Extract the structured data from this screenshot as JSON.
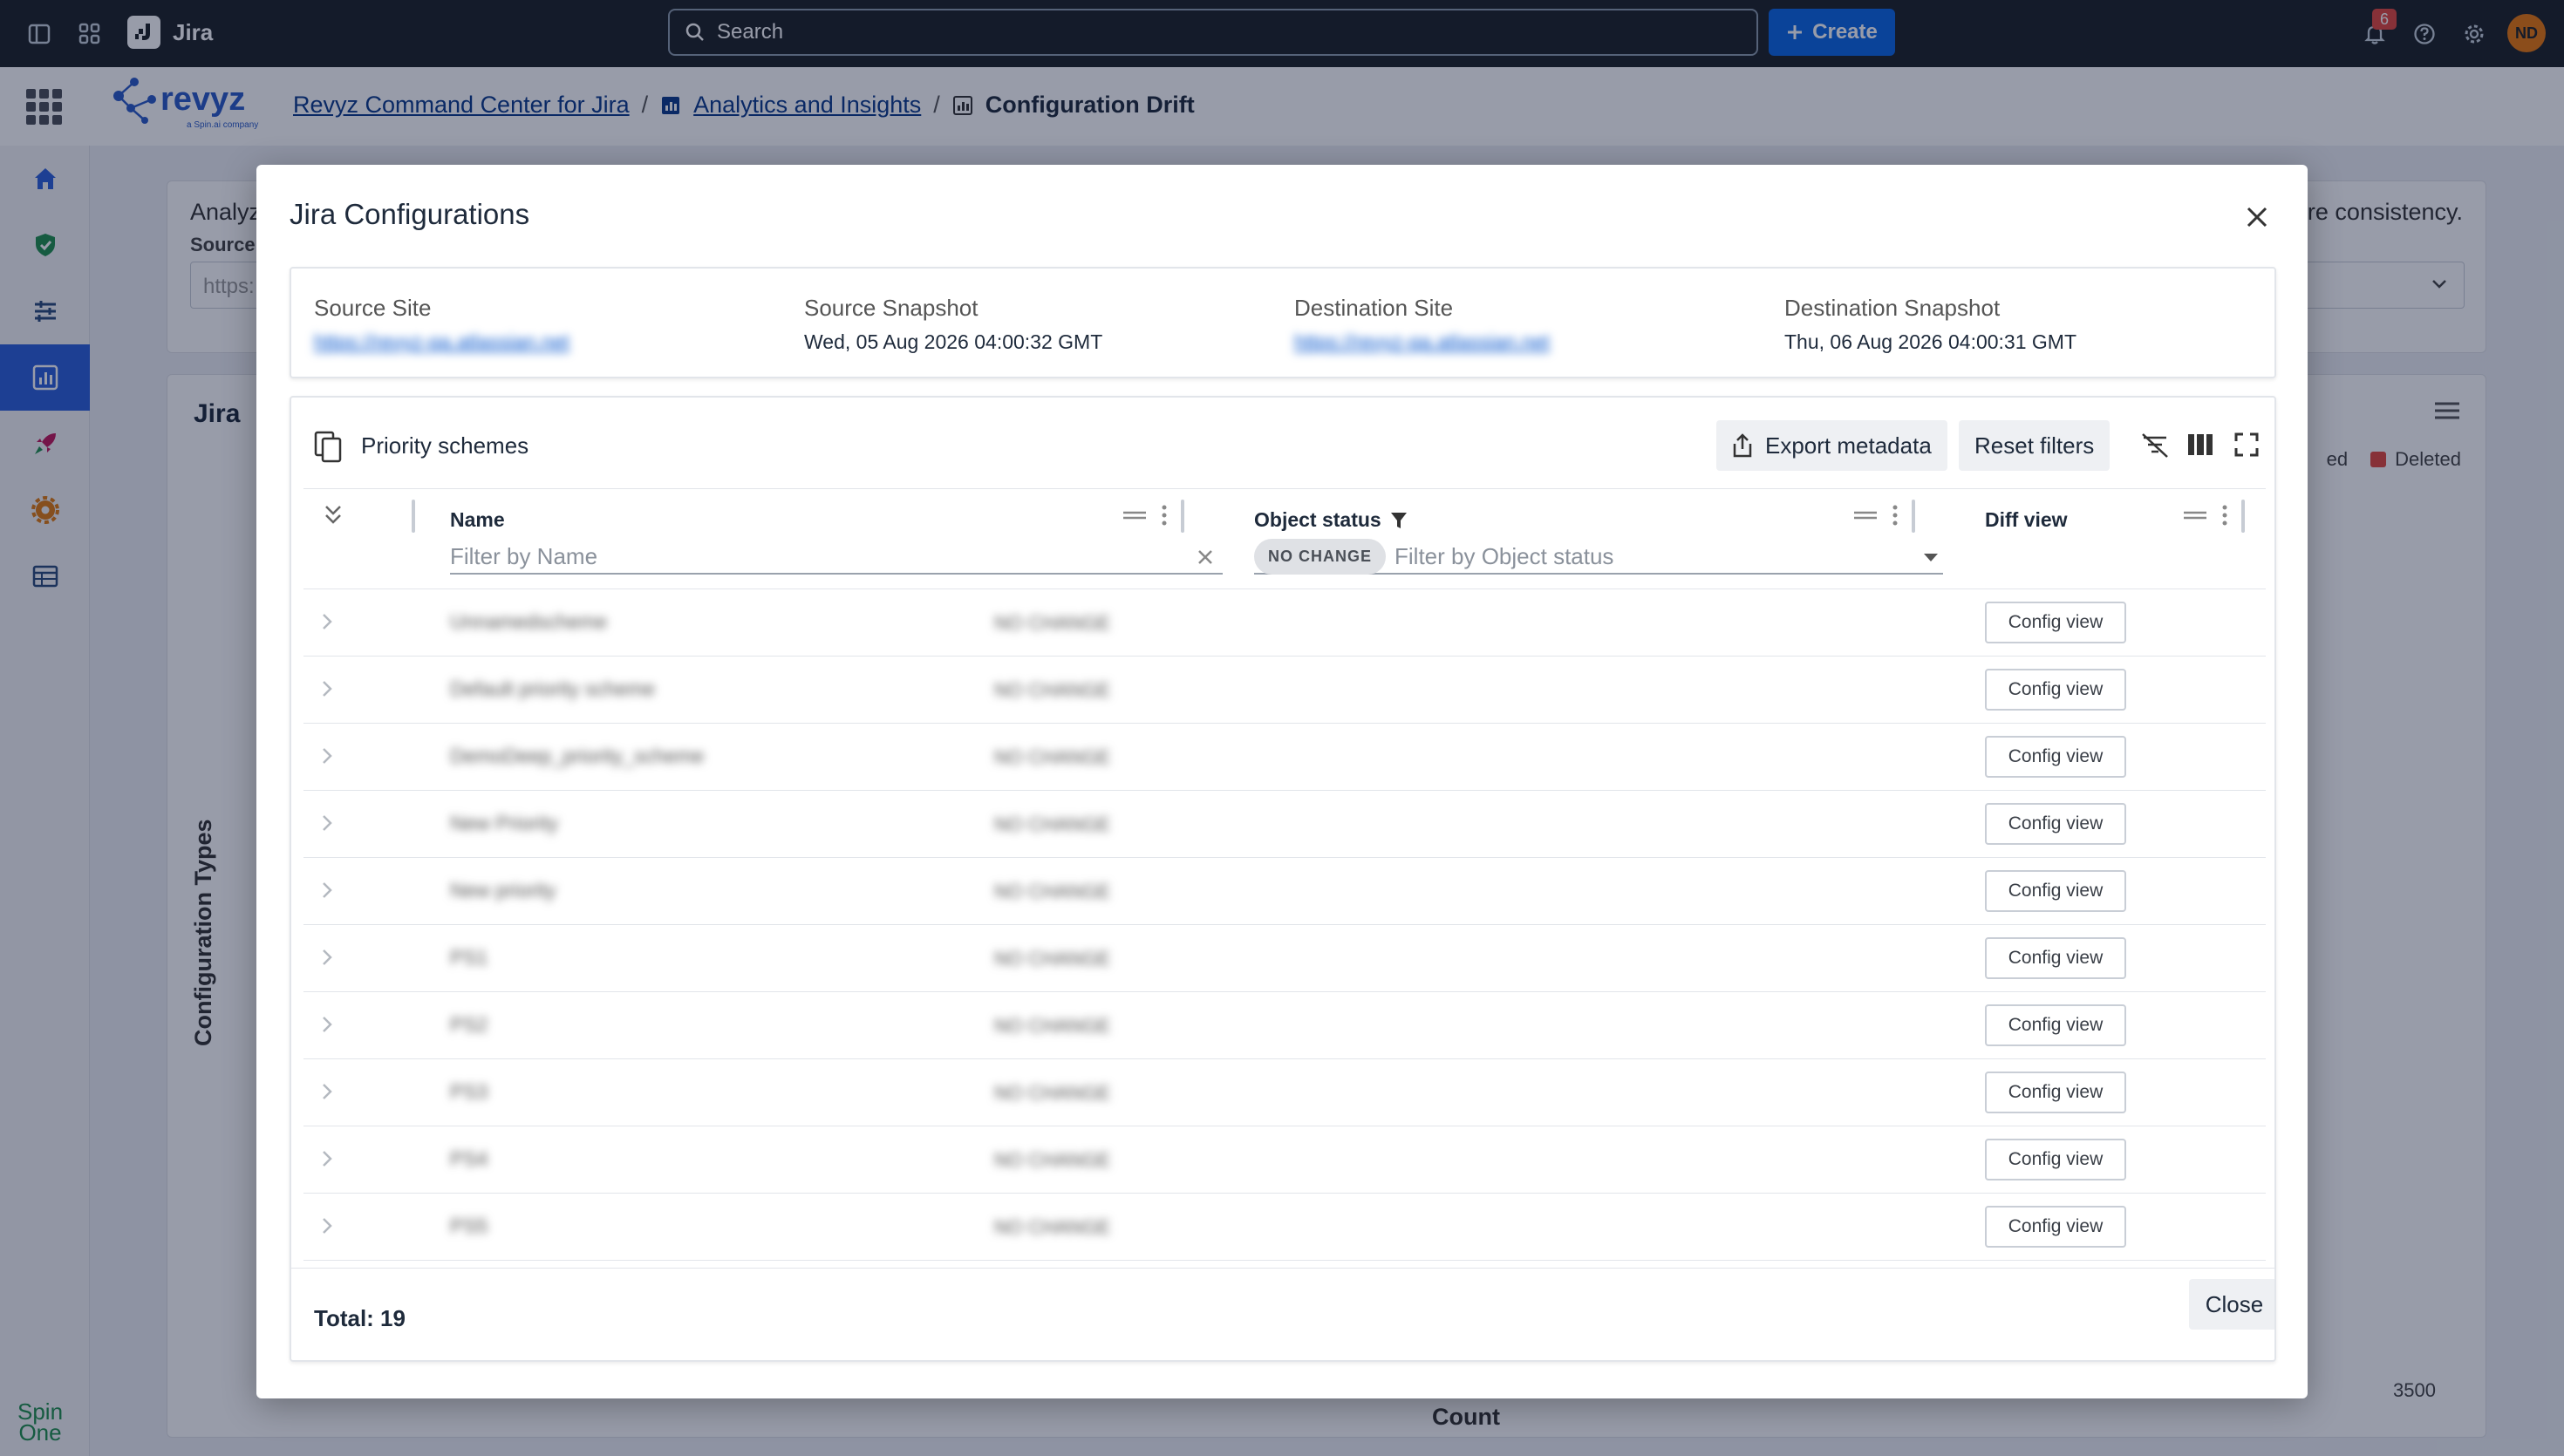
{
  "topbar": {
    "app_name": "Jira",
    "search_placeholder": "Search",
    "create_label": "Create",
    "notification_count": "6",
    "avatar_initials": "ND"
  },
  "breadcrumb": {
    "app": "Revyz Command Center for Jira",
    "section": "Analytics and Insights",
    "current": "Configuration Drift"
  },
  "background": {
    "intro_prefix": "Analyz",
    "intro_suffix": "re consistency.",
    "source_label": "Source",
    "source_url_prefix": "https:",
    "chart_title_prefix": "Jira",
    "legend_partial": "ed",
    "legend_deleted": "Deleted",
    "y_axis_label": "Configuration Types",
    "x_axis_label": "Count",
    "x_max_tick": "3500",
    "logo_line1": "Spin",
    "logo_line2": "One"
  },
  "modal": {
    "title": "Jira Configurations",
    "info": {
      "source_site_label": "Source Site",
      "source_site_url": "https://revyz-qa.atlassian.net",
      "source_snapshot_label": "Source Snapshot",
      "source_snapshot_value": "Wed, 05 Aug 2026 04:00:32 GMT",
      "dest_site_label": "Destination Site",
      "dest_site_url": "https://revyz-qa.atlassian.net",
      "dest_snapshot_label": "Destination Snapshot",
      "dest_snapshot_value": "Thu, 06 Aug 2026 04:00:31 GMT"
    },
    "table": {
      "title": "Priority schemes",
      "export_label": "Export metadata",
      "reset_label": "Reset filters",
      "col_name": "Name",
      "col_status": "Object status",
      "col_diff": "Diff view",
      "name_filter_placeholder": "Filter by Name",
      "status_chip": "NO CHANGE",
      "status_filter_placeholder": "Filter by Object status",
      "config_view_label": "Config view",
      "rows": [
        {
          "name": "Unnamedscheme",
          "status": "NO CHANGE"
        },
        {
          "name": "Default priority scheme",
          "status": "NO CHANGE"
        },
        {
          "name": "DemoDeep_priority_scheme",
          "status": "NO CHANGE"
        },
        {
          "name": "New Priority",
          "status": "NO CHANGE"
        },
        {
          "name": "New priority",
          "status": "NO CHANGE"
        },
        {
          "name": "PS1",
          "status": "NO CHANGE"
        },
        {
          "name": "PS2",
          "status": "NO CHANGE"
        },
        {
          "name": "PS3",
          "status": "NO CHANGE"
        },
        {
          "name": "PS4",
          "status": "NO CHANGE"
        },
        {
          "name": "PS5",
          "status": "NO CHANGE"
        }
      ],
      "total_label": "Total: 19",
      "close_label": "Close"
    }
  },
  "colors": {
    "topbar": "#1d2125",
    "primary": "#0c66e4",
    "nav_active": "#2b5fd9",
    "deleted": "#e2483d"
  }
}
